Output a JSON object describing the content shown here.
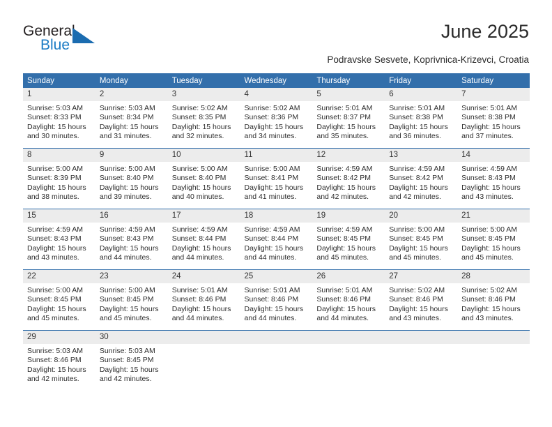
{
  "brand": {
    "name_part1": "General",
    "name_part2": "Blue",
    "accent_color": "#1b7bc4"
  },
  "header": {
    "month_title": "June 2025",
    "location": "Podravske Sesvete, Koprivnica-Krizevci, Croatia"
  },
  "calendar": {
    "header_color": "#336fab",
    "weekday_headers": [
      "Sunday",
      "Monday",
      "Tuesday",
      "Wednesday",
      "Thursday",
      "Friday",
      "Saturday"
    ],
    "weeks": [
      [
        {
          "day": "1",
          "sunrise": "Sunrise: 5:03 AM",
          "sunset": "Sunset: 8:33 PM",
          "daylight1": "Daylight: 15 hours",
          "daylight2": "and 30 minutes."
        },
        {
          "day": "2",
          "sunrise": "Sunrise: 5:03 AM",
          "sunset": "Sunset: 8:34 PM",
          "daylight1": "Daylight: 15 hours",
          "daylight2": "and 31 minutes."
        },
        {
          "day": "3",
          "sunrise": "Sunrise: 5:02 AM",
          "sunset": "Sunset: 8:35 PM",
          "daylight1": "Daylight: 15 hours",
          "daylight2": "and 32 minutes."
        },
        {
          "day": "4",
          "sunrise": "Sunrise: 5:02 AM",
          "sunset": "Sunset: 8:36 PM",
          "daylight1": "Daylight: 15 hours",
          "daylight2": "and 34 minutes."
        },
        {
          "day": "5",
          "sunrise": "Sunrise: 5:01 AM",
          "sunset": "Sunset: 8:37 PM",
          "daylight1": "Daylight: 15 hours",
          "daylight2": "and 35 minutes."
        },
        {
          "day": "6",
          "sunrise": "Sunrise: 5:01 AM",
          "sunset": "Sunset: 8:38 PM",
          "daylight1": "Daylight: 15 hours",
          "daylight2": "and 36 minutes."
        },
        {
          "day": "7",
          "sunrise": "Sunrise: 5:01 AM",
          "sunset": "Sunset: 8:38 PM",
          "daylight1": "Daylight: 15 hours",
          "daylight2": "and 37 minutes."
        }
      ],
      [
        {
          "day": "8",
          "sunrise": "Sunrise: 5:00 AM",
          "sunset": "Sunset: 8:39 PM",
          "daylight1": "Daylight: 15 hours",
          "daylight2": "and 38 minutes."
        },
        {
          "day": "9",
          "sunrise": "Sunrise: 5:00 AM",
          "sunset": "Sunset: 8:40 PM",
          "daylight1": "Daylight: 15 hours",
          "daylight2": "and 39 minutes."
        },
        {
          "day": "10",
          "sunrise": "Sunrise: 5:00 AM",
          "sunset": "Sunset: 8:40 PM",
          "daylight1": "Daylight: 15 hours",
          "daylight2": "and 40 minutes."
        },
        {
          "day": "11",
          "sunrise": "Sunrise: 5:00 AM",
          "sunset": "Sunset: 8:41 PM",
          "daylight1": "Daylight: 15 hours",
          "daylight2": "and 41 minutes."
        },
        {
          "day": "12",
          "sunrise": "Sunrise: 4:59 AM",
          "sunset": "Sunset: 8:42 PM",
          "daylight1": "Daylight: 15 hours",
          "daylight2": "and 42 minutes."
        },
        {
          "day": "13",
          "sunrise": "Sunrise: 4:59 AM",
          "sunset": "Sunset: 8:42 PM",
          "daylight1": "Daylight: 15 hours",
          "daylight2": "and 42 minutes."
        },
        {
          "day": "14",
          "sunrise": "Sunrise: 4:59 AM",
          "sunset": "Sunset: 8:43 PM",
          "daylight1": "Daylight: 15 hours",
          "daylight2": "and 43 minutes."
        }
      ],
      [
        {
          "day": "15",
          "sunrise": "Sunrise: 4:59 AM",
          "sunset": "Sunset: 8:43 PM",
          "daylight1": "Daylight: 15 hours",
          "daylight2": "and 43 minutes."
        },
        {
          "day": "16",
          "sunrise": "Sunrise: 4:59 AM",
          "sunset": "Sunset: 8:43 PM",
          "daylight1": "Daylight: 15 hours",
          "daylight2": "and 44 minutes."
        },
        {
          "day": "17",
          "sunrise": "Sunrise: 4:59 AM",
          "sunset": "Sunset: 8:44 PM",
          "daylight1": "Daylight: 15 hours",
          "daylight2": "and 44 minutes."
        },
        {
          "day": "18",
          "sunrise": "Sunrise: 4:59 AM",
          "sunset": "Sunset: 8:44 PM",
          "daylight1": "Daylight: 15 hours",
          "daylight2": "and 44 minutes."
        },
        {
          "day": "19",
          "sunrise": "Sunrise: 4:59 AM",
          "sunset": "Sunset: 8:45 PM",
          "daylight1": "Daylight: 15 hours",
          "daylight2": "and 45 minutes."
        },
        {
          "day": "20",
          "sunrise": "Sunrise: 5:00 AM",
          "sunset": "Sunset: 8:45 PM",
          "daylight1": "Daylight: 15 hours",
          "daylight2": "and 45 minutes."
        },
        {
          "day": "21",
          "sunrise": "Sunrise: 5:00 AM",
          "sunset": "Sunset: 8:45 PM",
          "daylight1": "Daylight: 15 hours",
          "daylight2": "and 45 minutes."
        }
      ],
      [
        {
          "day": "22",
          "sunrise": "Sunrise: 5:00 AM",
          "sunset": "Sunset: 8:45 PM",
          "daylight1": "Daylight: 15 hours",
          "daylight2": "and 45 minutes."
        },
        {
          "day": "23",
          "sunrise": "Sunrise: 5:00 AM",
          "sunset": "Sunset: 8:45 PM",
          "daylight1": "Daylight: 15 hours",
          "daylight2": "and 45 minutes."
        },
        {
          "day": "24",
          "sunrise": "Sunrise: 5:01 AM",
          "sunset": "Sunset: 8:46 PM",
          "daylight1": "Daylight: 15 hours",
          "daylight2": "and 44 minutes."
        },
        {
          "day": "25",
          "sunrise": "Sunrise: 5:01 AM",
          "sunset": "Sunset: 8:46 PM",
          "daylight1": "Daylight: 15 hours",
          "daylight2": "and 44 minutes."
        },
        {
          "day": "26",
          "sunrise": "Sunrise: 5:01 AM",
          "sunset": "Sunset: 8:46 PM",
          "daylight1": "Daylight: 15 hours",
          "daylight2": "and 44 minutes."
        },
        {
          "day": "27",
          "sunrise": "Sunrise: 5:02 AM",
          "sunset": "Sunset: 8:46 PM",
          "daylight1": "Daylight: 15 hours",
          "daylight2": "and 43 minutes."
        },
        {
          "day": "28",
          "sunrise": "Sunrise: 5:02 AM",
          "sunset": "Sunset: 8:46 PM",
          "daylight1": "Daylight: 15 hours",
          "daylight2": "and 43 minutes."
        }
      ],
      [
        {
          "day": "29",
          "sunrise": "Sunrise: 5:03 AM",
          "sunset": "Sunset: 8:46 PM",
          "daylight1": "Daylight: 15 hours",
          "daylight2": "and 42 minutes."
        },
        {
          "day": "30",
          "sunrise": "Sunrise: 5:03 AM",
          "sunset": "Sunset: 8:45 PM",
          "daylight1": "Daylight: 15 hours",
          "daylight2": "and 42 minutes."
        },
        {
          "day": "",
          "sunrise": "",
          "sunset": "",
          "daylight1": "",
          "daylight2": ""
        },
        {
          "day": "",
          "sunrise": "",
          "sunset": "",
          "daylight1": "",
          "daylight2": ""
        },
        {
          "day": "",
          "sunrise": "",
          "sunset": "",
          "daylight1": "",
          "daylight2": ""
        },
        {
          "day": "",
          "sunrise": "",
          "sunset": "",
          "daylight1": "",
          "daylight2": ""
        },
        {
          "day": "",
          "sunrise": "",
          "sunset": "",
          "daylight1": "",
          "daylight2": ""
        }
      ]
    ]
  }
}
